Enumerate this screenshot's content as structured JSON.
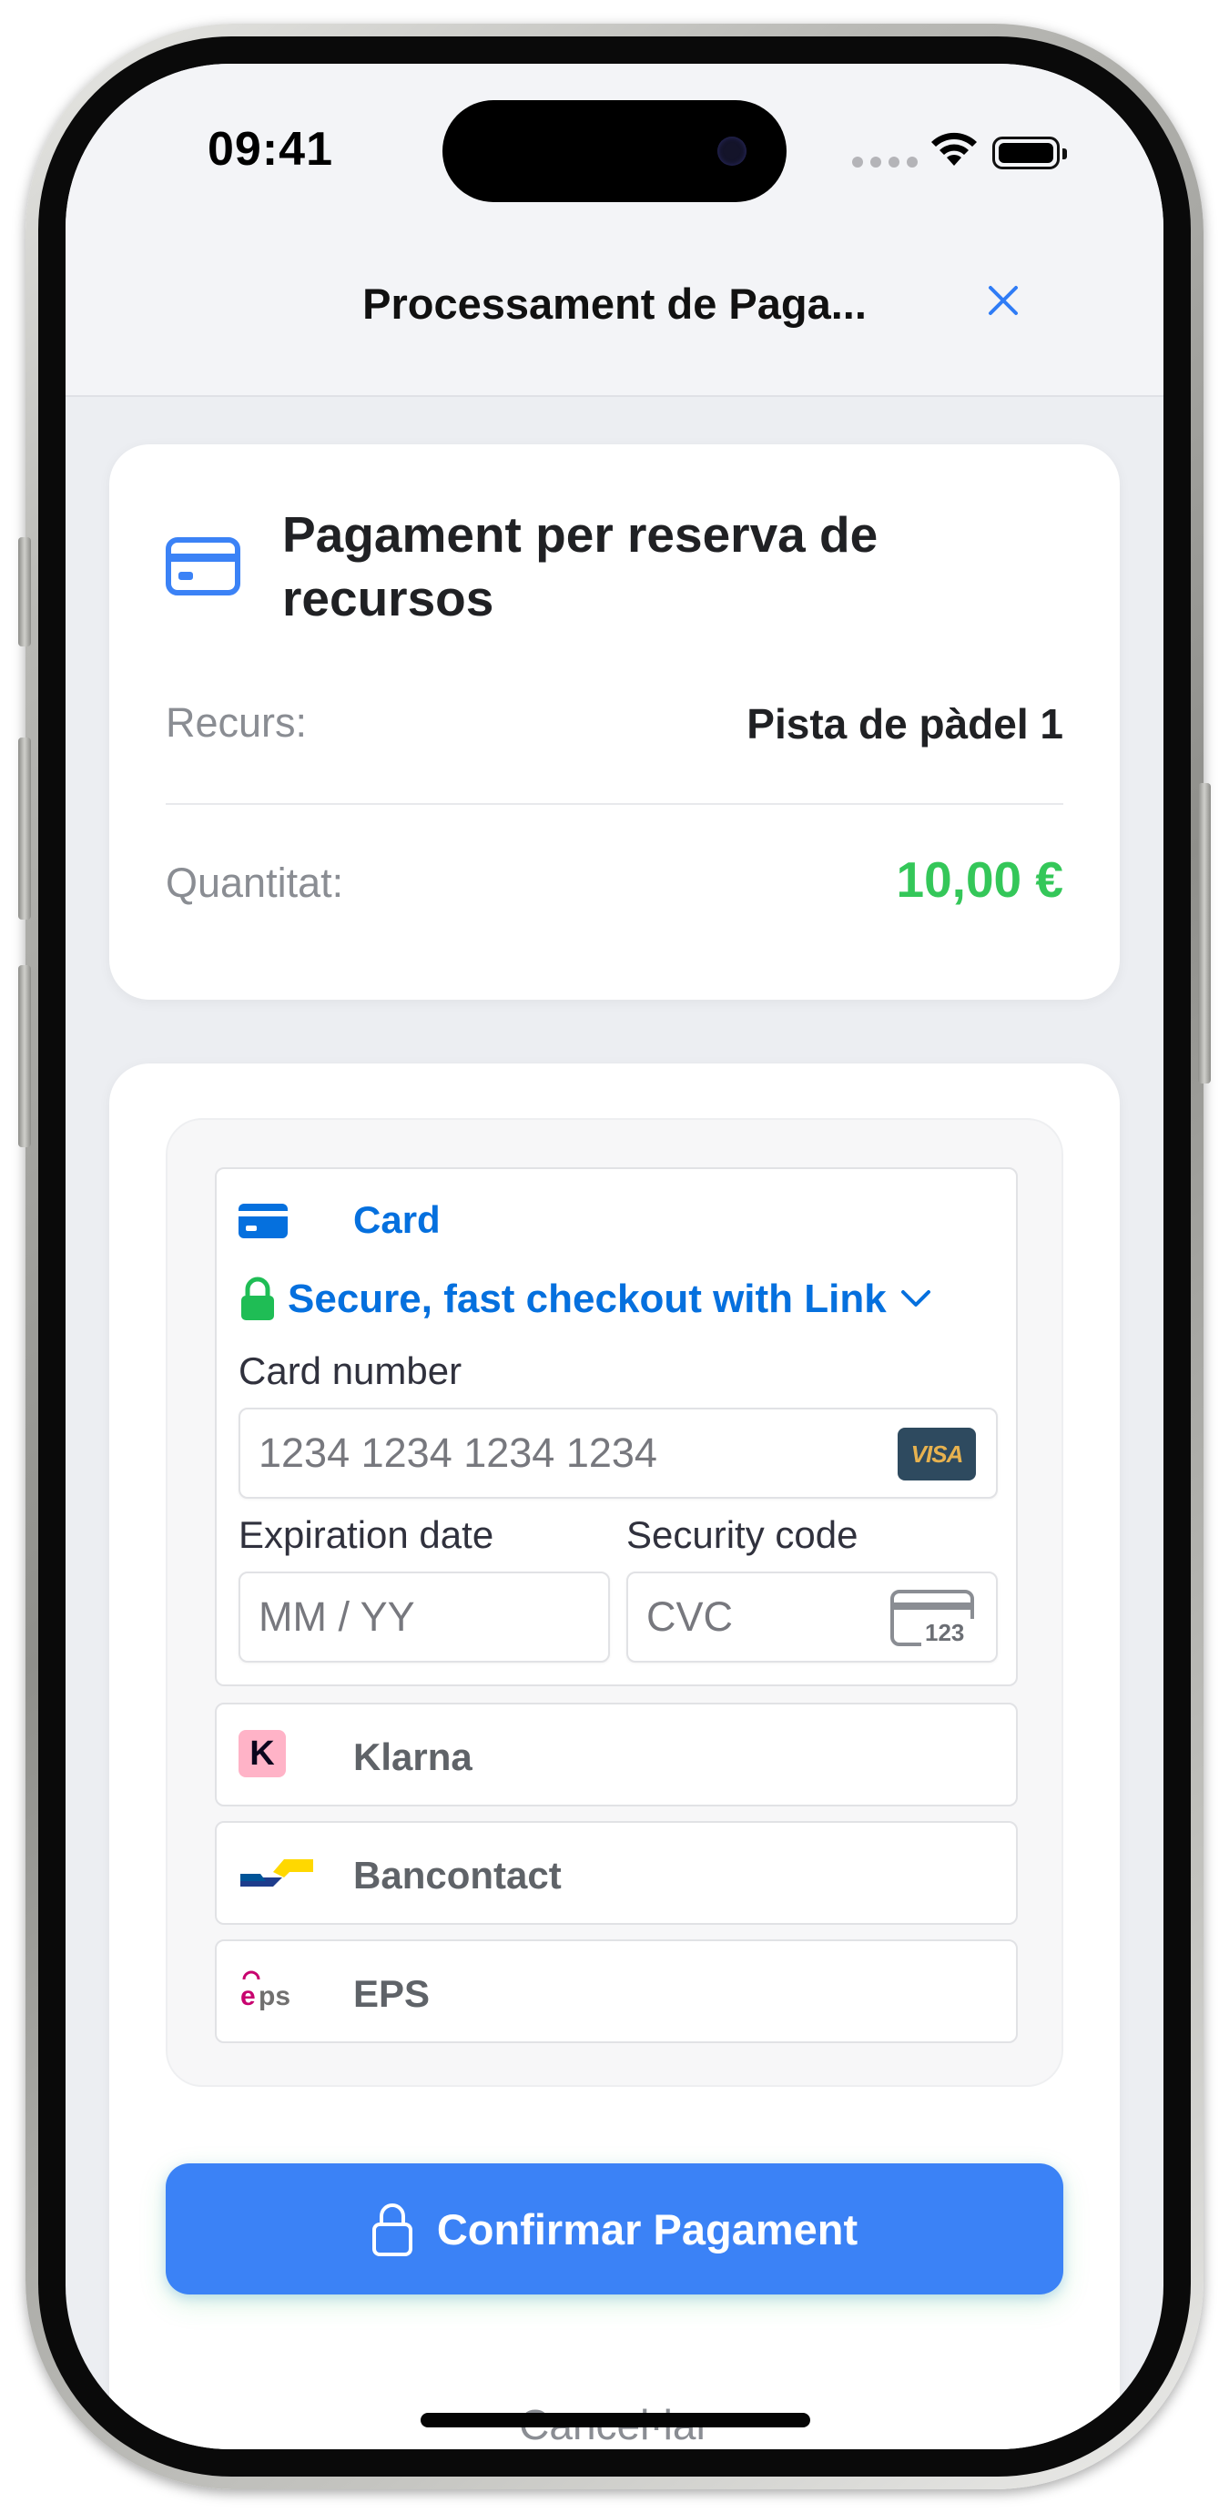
{
  "status_bar": {
    "time": "09:41"
  },
  "header": {
    "title": "Processament de Paga...",
    "close_icon": "close-icon"
  },
  "summary": {
    "title": "Pagament per reserva de recursos",
    "resource_label": "Recurs:",
    "resource_value": "Pista de pàdel 1",
    "amount_label": "Quantitat:",
    "amount_value": "10,00 €",
    "amount_color": "#34c759",
    "icon": "credit-card-icon"
  },
  "payment_methods": {
    "card": {
      "label": "Card",
      "link_text": "Secure, fast checkout with Link",
      "card_number_label": "Card number",
      "card_number_placeholder": "1234 1234 1234 1234",
      "card_brand": "VISA",
      "expiration_label": "Expiration date",
      "expiration_placeholder": "MM / YY",
      "security_label": "Security code",
      "security_placeholder": "CVC",
      "cvc_icon_text": "123"
    },
    "klarna": {
      "label": "Klarna",
      "icon_text": "K"
    },
    "bancontact": {
      "label": "Bancontact"
    },
    "eps": {
      "label": "EPS",
      "icon_text": "eps"
    }
  },
  "actions": {
    "confirm_label": "Confirmar Pagament",
    "cancel_label": "Cancel·lar"
  },
  "colors": {
    "accent": "#3b82f6",
    "stripe_blue": "#0570de",
    "success": "#34c759"
  }
}
